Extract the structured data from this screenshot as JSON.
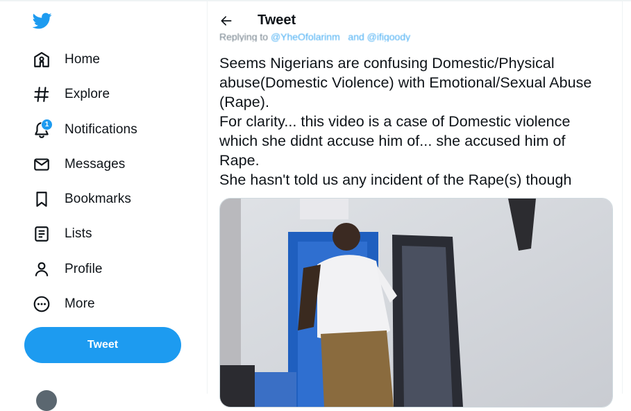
{
  "sidebar": {
    "items": [
      {
        "label": "Home",
        "icon": "home-icon"
      },
      {
        "label": "Explore",
        "icon": "hashtag-icon"
      },
      {
        "label": "Notifications",
        "icon": "bell-icon"
      },
      {
        "label": "Messages",
        "icon": "envelope-icon"
      },
      {
        "label": "Bookmarks",
        "icon": "bookmark-icon"
      },
      {
        "label": "Lists",
        "icon": "list-icon"
      },
      {
        "label": "Profile",
        "icon": "person-icon"
      },
      {
        "label": "More",
        "icon": "more-circle-icon"
      }
    ],
    "notifications_badge": "1",
    "tweet_button": "Tweet"
  },
  "header": {
    "title": "Tweet"
  },
  "tweet": {
    "replying_prefix": "Replying to ",
    "replying_handles": "@YheOfolarinm_ and @ifigoody_",
    "text": "Seems Nigerians are confusing Domestic/Physical abuse(Domestic Violence) with Emotional/Sexual Abuse (Rape).\nFor clarity... this video is a case of Domestic violence which she didnt accuse him of... she accused him of Rape.\nShe hasn't told us any incident of the Rape(s) though"
  },
  "colors": {
    "accent": "#1d9bf0",
    "text": "#0f1419",
    "secondary": "#536471"
  }
}
